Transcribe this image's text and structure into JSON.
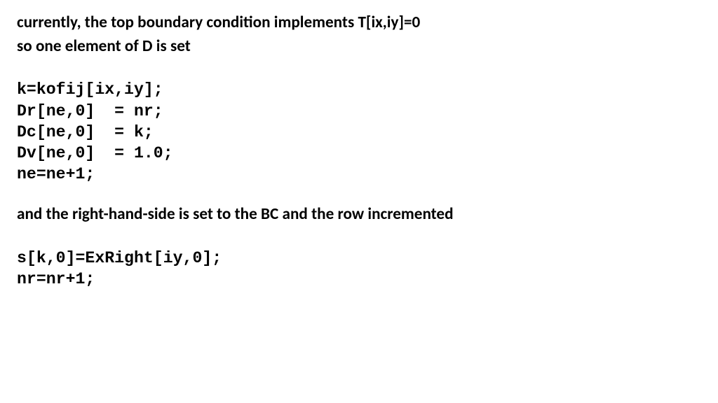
{
  "line1": "currently, the top boundary condition implements T[ix,iy]=0",
  "line2": "so one element of D is set",
  "code1": "k=kofij[ix,iy];\nDr[ne,0]  = nr;\nDc[ne,0]  = k;\nDv[ne,0]  = 1.0;\nne=ne+1;",
  "line3": "and the right-hand-side is set to the BC and the row incremented",
  "code2": "s[k,0]=ExRight[iy,0];\nnr=nr+1;"
}
